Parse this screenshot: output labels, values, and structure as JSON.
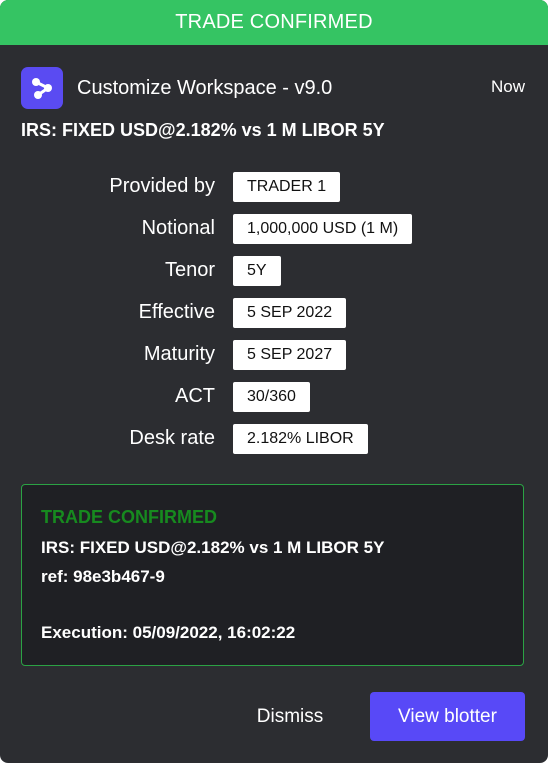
{
  "banner": {
    "text": "TRADE CONFIRMED"
  },
  "header": {
    "app_name": "Customize Workspace - v9.0",
    "time": "Now",
    "logo_icon": "network-nodes-icon"
  },
  "trade_title": "IRS: FIXED USD@2.182% vs 1 M LIBOR 5Y",
  "fields": [
    {
      "label": "Provided by",
      "value": "TRADER 1"
    },
    {
      "label": "Notional",
      "value": "1,000,000 USD (1 M)"
    },
    {
      "label": "Tenor",
      "value": "5Y"
    },
    {
      "label": "Effective",
      "value": "5 SEP 2022"
    },
    {
      "label": "Maturity",
      "value": "5 SEP 2027"
    },
    {
      "label": "ACT",
      "value": "30/360"
    },
    {
      "label": "Desk rate",
      "value": "2.182% LIBOR"
    }
  ],
  "confirmation": {
    "title": "TRADE CONFIRMED",
    "trade": "IRS: FIXED USD@2.182% vs 1 M LIBOR 5Y",
    "ref": "ref: 98e3b467-9",
    "execution": "Execution: 05/09/2022, 16:02:22"
  },
  "actions": {
    "dismiss": "Dismiss",
    "view_blotter": "View blotter"
  },
  "colors": {
    "banner": "#35c463",
    "accent": "#5849f7",
    "card": "#2c2d31",
    "confirm_title": "#178a1f"
  }
}
